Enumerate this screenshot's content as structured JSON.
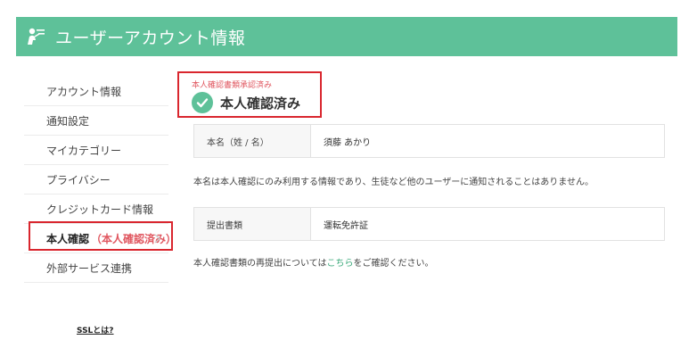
{
  "header": {
    "title": "ユーザーアカウント情報",
    "icon": "user-icon",
    "bg_color": "#5ec199"
  },
  "sidebar": {
    "items": [
      {
        "label": "アカウント情報"
      },
      {
        "label": "通知設定"
      },
      {
        "label": "マイカテゴリー"
      },
      {
        "label": "プライバシー"
      },
      {
        "label": "クレジットカード情報"
      },
      {
        "label": "本人確認",
        "badge": "（本人確認済み）"
      },
      {
        "label": "外部サービス連携"
      }
    ],
    "active_index": 5
  },
  "status": {
    "small_text": "本人確認書類承認済み",
    "main_text": "本人確認済み",
    "icon": "check-circle-icon"
  },
  "name_row": {
    "label": "本名（姓 / 名）",
    "value": "須藤 あかり"
  },
  "name_note": "本名は本人確認にのみ利用する情報であり、生徒など他のユーザーに通知されることはありません。",
  "document_row": {
    "label": "提出書類",
    "value": "運転免許証"
  },
  "resubmit_note": {
    "before": "本人確認書類の再提出については",
    "link": "こちら",
    "after": "をご確認ください。"
  },
  "footer": {
    "ssl_label": "SSLとは?"
  },
  "colors": {
    "accent": "#5ec199",
    "highlight_border": "#d9262e",
    "badge_text": "#e0565f"
  }
}
